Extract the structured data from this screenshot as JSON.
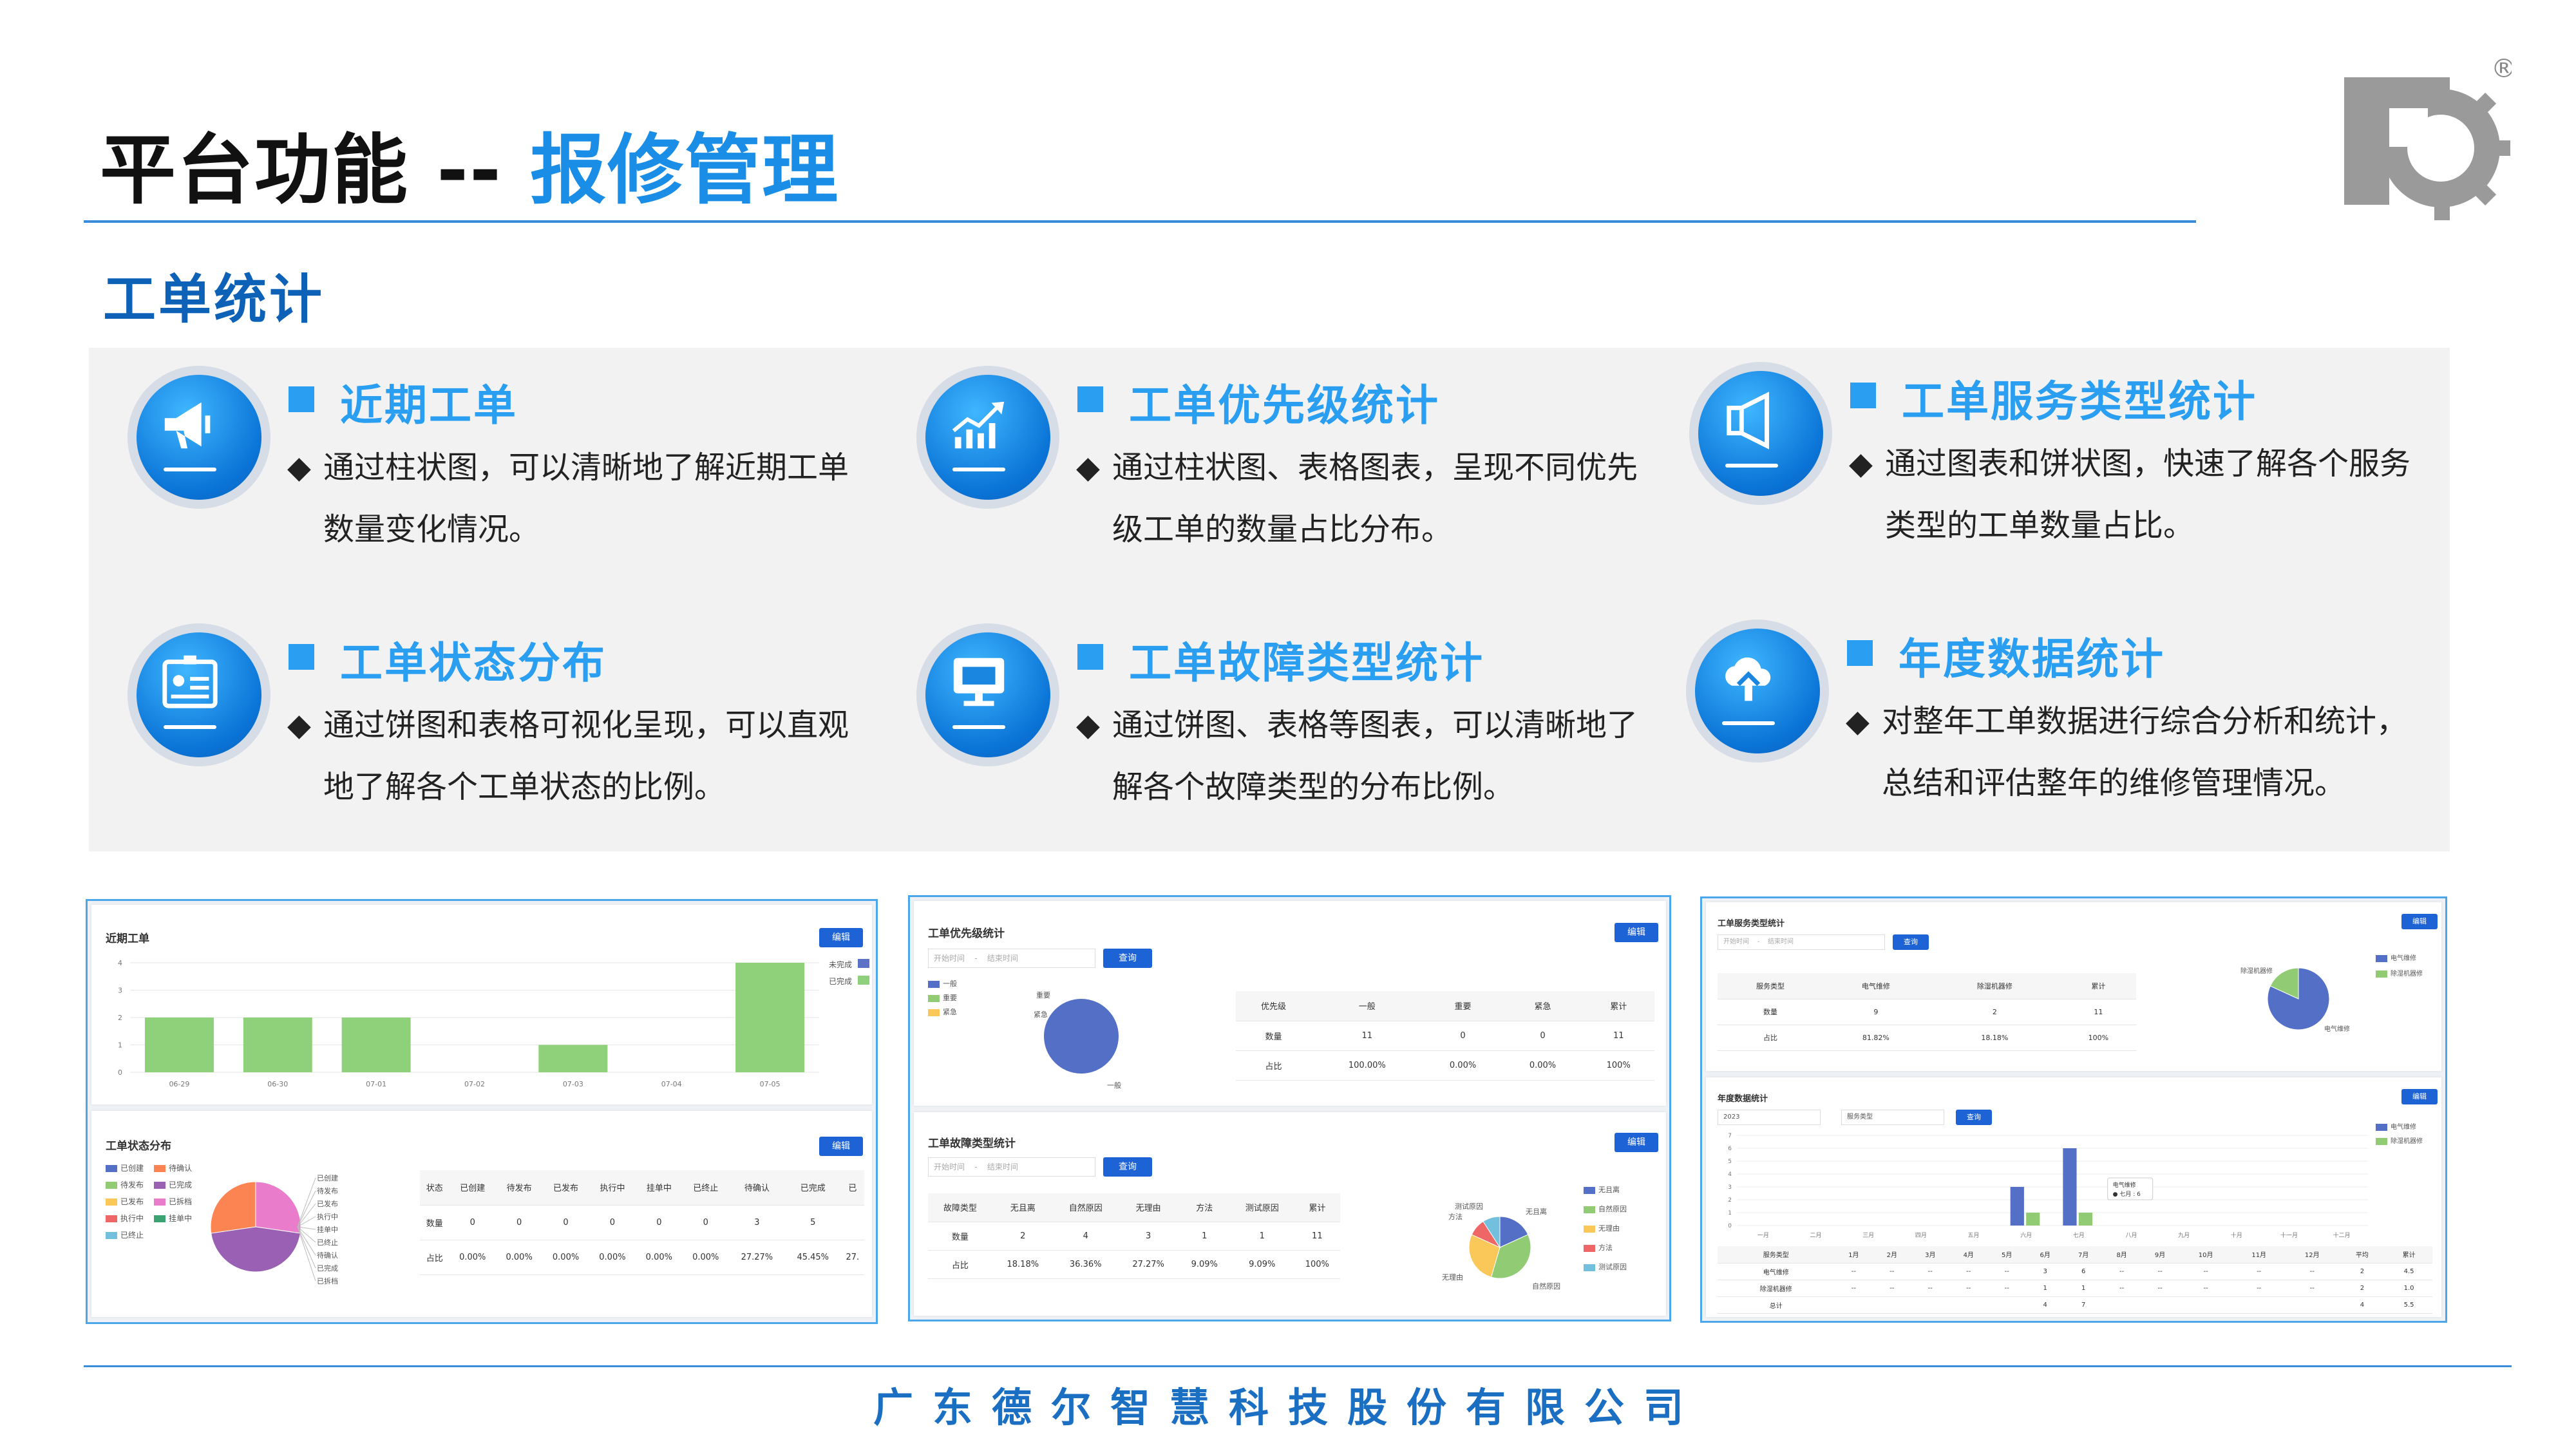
{
  "header": {
    "title_prefix": "平台功能 -- ",
    "title_accent": "报修管理",
    "logo_mark": "®"
  },
  "section_title": "工单统计",
  "features": [
    {
      "head": "近期工单",
      "line1": "通过柱状图，可以清晰地了解近期工单",
      "line2": "数量变化情况。",
      "icon": "megaphone-icon"
    },
    {
      "head": "工单优先级统计",
      "line1": "通过柱状图、表格图表，呈现不同优先",
      "line2": "级工单的数量占比分布。",
      "icon": "trend-chart-icon"
    },
    {
      "head": "工单服务类型统计",
      "line1": "通过图表和饼状图，快速了解各个服务",
      "line2": "类型的工单数量占比。",
      "icon": "speaker-icon"
    },
    {
      "head": "工单状态分布",
      "line1": "通过饼图和表格可视化呈现，可以直观",
      "line2": "地了解各个工单状态的比例。",
      "icon": "id-card-icon"
    },
    {
      "head": "工单故障类型统计",
      "line1": "通过饼图、表格等图表，可以清晰地了",
      "line2": "解各个故障类型的分布比例。",
      "icon": "monitor-icon"
    },
    {
      "head": "年度数据统计",
      "line1": "对整年工单数据进行综合分析和统计，",
      "line2": "总结和评估整年的维修管理情况。",
      "icon": "cloud-icon"
    }
  ],
  "diamond": "◆",
  "screens": {
    "s1": {
      "recent": {
        "title": "近期工单",
        "btn": "编辑",
        "legend": [
          "未完成",
          "已完成"
        ]
      },
      "status": {
        "title": "工单状态分布",
        "btn": "编辑",
        "legend": [
          "已创建",
          "待确认",
          "待发布",
          "已完成",
          "已发布",
          "已拆档",
          "执行中",
          "挂单中",
          "已终止"
        ],
        "pie_labels": [
          "已创建",
          "待发布",
          "已发布",
          "执行中",
          "挂单中",
          "已终止",
          "待确认",
          "已完成",
          "已拆档"
        ],
        "table": {
          "head": [
            "状态",
            "已创建",
            "待发布",
            "已发布",
            "执行中",
            "挂单中",
            "已终止",
            "待确认",
            "已完成",
            "已"
          ],
          "rows": [
            [
              "数量",
              "0",
              "0",
              "0",
              "0",
              "0",
              "0",
              "3",
              "5",
              ""
            ],
            [
              "占比",
              "0.00%",
              "0.00%",
              "0.00%",
              "0.00%",
              "0.00%",
              "0.00%",
              "27.27%",
              "45.45%",
              "27."
            ]
          ]
        }
      }
    },
    "s2": {
      "priority": {
        "title": "工单优先级统计",
        "btn": "编辑",
        "start": "开始时间",
        "end": "结束时间",
        "query": "查询",
        "legend": [
          "一般",
          "重要",
          "紧急"
        ],
        "pie_labels": [
          "重要",
          "紧急",
          "一般"
        ],
        "table": {
          "head": [
            "优先级",
            "一般",
            "重要",
            "紧急",
            "累计"
          ],
          "rows": [
            [
              "数量",
              "11",
              "0",
              "0",
              "11"
            ],
            [
              "占比",
              "100.00%",
              "0.00%",
              "0.00%",
              "100%"
            ]
          ]
        }
      },
      "fault": {
        "title": "工单故障类型统计",
        "btn": "编辑",
        "start": "开始时间",
        "end": "结束时间",
        "query": "查询",
        "table": {
          "head": [
            "故障类型",
            "无且离",
            "自然原因",
            "无理由",
            "方法",
            "测试原因",
            "累计"
          ],
          "rows": [
            [
              "数量",
              "2",
              "4",
              "3",
              "1",
              "1",
              "11"
            ],
            [
              "占比",
              "18.18%",
              "36.36%",
              "27.27%",
              "9.09%",
              "9.09%",
              "100%"
            ]
          ]
        },
        "pie_labels": [
          "测试原因",
          "方法",
          "无且离",
          "无理由",
          "自然原因"
        ],
        "legend": [
          "无且离",
          "自然原因",
          "无理由",
          "方法",
          "测试原因"
        ]
      }
    },
    "s3": {
      "service": {
        "title": "工单服务类型统计",
        "btn": "编辑",
        "start": "开始时间",
        "end": "结束时间",
        "query": "查询",
        "table": {
          "head": [
            "服务类型",
            "电气维修",
            "除湿机器修",
            "累计"
          ],
          "rows": [
            [
              "数量",
              "9",
              "2",
              "11"
            ],
            [
              "占比",
              "81.82%",
              "18.18%",
              "100%"
            ]
          ]
        },
        "pie_labels": [
          "除湿机器修",
          "电气维修"
        ],
        "legend": [
          "电气维修",
          "除湿机器修"
        ]
      },
      "annual": {
        "title": "年度数据统计",
        "btn": "编辑",
        "year": "2023",
        "type": "服务类型",
        "query": "查询",
        "legend": [
          "电气维修",
          "除湿机器修"
        ],
        "months": [
          "一月",
          "二月",
          "三月",
          "四月",
          "五月",
          "六月",
          "七月",
          "八月",
          "九月",
          "十月",
          "十一月",
          "十二月"
        ],
        "tooltip": [
          "电气维修",
          "● 七月 : 6"
        ],
        "table": {
          "head": [
            "服务类型",
            "1月",
            "2月",
            "3月",
            "4月",
            "5月",
            "6月",
            "7月",
            "8月",
            "9月",
            "10月",
            "11月",
            "12月",
            "平均",
            "累计"
          ],
          "rows": [
            [
              "电气维修",
              "--",
              "--",
              "--",
              "--",
              "--",
              "3",
              "6",
              "--",
              "--",
              "--",
              "--",
              "--",
              "2",
              "4.5"
            ],
            [
              "除湿机器修",
              "--",
              "--",
              "--",
              "--",
              "--",
              "1",
              "1",
              "--",
              "--",
              "--",
              "--",
              "--",
              "2",
              "1.0"
            ],
            [
              "总计",
              "",
              "",
              "",
              "",
              "",
              "4",
              "7",
              "",
              "",
              "",
              "",
              "",
              "4",
              "5.5"
            ]
          ]
        }
      }
    }
  },
  "chart_data": [
    {
      "type": "bar",
      "title": "近期工单",
      "categories": [
        "06-29",
        "06-30",
        "07-01",
        "07-02",
        "07-03",
        "07-04",
        "07-05"
      ],
      "series": [
        {
          "name": "已完成",
          "values": [
            2,
            2,
            2,
            0,
            1,
            0,
            4
          ]
        }
      ],
      "ylim": [
        0,
        4
      ],
      "yticks": [
        "0",
        "1",
        "2",
        "3",
        "4"
      ]
    },
    {
      "type": "bar",
      "title": "年度数据统计",
      "categories": [
        "一月",
        "二月",
        "三月",
        "四月",
        "五月",
        "六月",
        "七月",
        "八月",
        "九月",
        "十月",
        "十一月",
        "十二月"
      ],
      "series": [
        {
          "name": "电气维修",
          "values": [
            0,
            0,
            0,
            0,
            0,
            3,
            6,
            0,
            0,
            0,
            0,
            0
          ]
        },
        {
          "name": "除湿机器修",
          "values": [
            0,
            0,
            0,
            0,
            0,
            1,
            1,
            0,
            0,
            0,
            0,
            0
          ]
        }
      ],
      "ylim": [
        0,
        7
      ],
      "yticks": [
        "0",
        "1",
        "2",
        "3",
        "4",
        "5",
        "6",
        "7"
      ]
    }
  ],
  "footer": {
    "company": "广东德尔智慧科技股份有限公司"
  }
}
